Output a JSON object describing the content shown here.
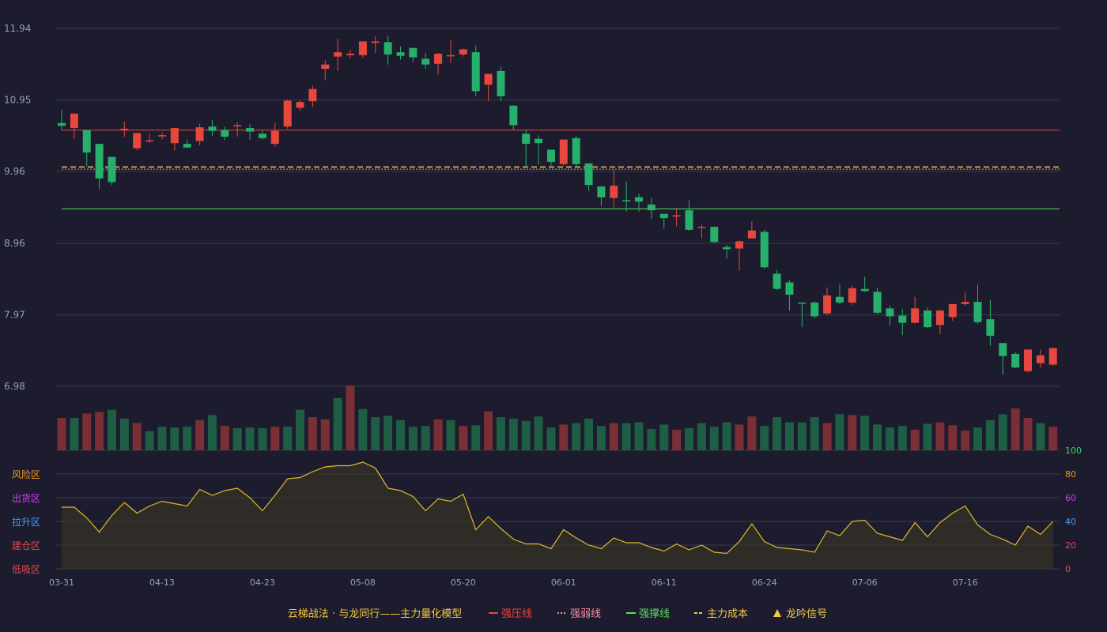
{
  "chart_data": [
    {
      "type": "candlestick",
      "y_ticks": [
        "11.94",
        "10.95",
        "9.96",
        "8.96",
        "7.97",
        "6.98"
      ],
      "ylim": [
        6.98,
        11.94
      ],
      "x_ticks": [
        "03-31",
        "04-13",
        "04-23",
        "05-08",
        "05-20",
        "06-01",
        "06-11",
        "06-24",
        "07-06",
        "07-16"
      ],
      "x_tick_index": [
        0,
        8,
        16,
        24,
        32,
        40,
        48,
        56,
        64,
        72
      ],
      "levels": {
        "strong_resistance": 10.53,
        "weak": 9.99,
        "strong_support": 9.44,
        "main_cost": 10.02
      },
      "candles": [
        [
          10.63,
          10.59,
          10.81,
          10.53
        ],
        [
          10.56,
          10.76,
          10.56,
          10.41
        ],
        [
          10.53,
          10.22,
          10.53,
          10.03
        ],
        [
          10.34,
          9.86,
          10.34,
          9.72
        ],
        [
          10.16,
          9.81,
          10.16,
          9.77
        ],
        [
          10.53,
          10.55,
          10.65,
          10.44
        ],
        [
          10.28,
          10.49,
          10.49,
          10.25
        ],
        [
          10.38,
          10.39,
          10.49,
          10.35
        ],
        [
          10.45,
          10.46,
          10.5,
          10.4
        ],
        [
          10.35,
          10.56,
          10.56,
          10.25
        ],
        [
          10.34,
          10.29,
          10.4,
          10.28
        ],
        [
          10.38,
          10.57,
          10.62,
          10.32
        ],
        [
          10.58,
          10.52,
          10.67,
          10.45
        ],
        [
          10.53,
          10.44,
          10.58,
          10.39
        ],
        [
          10.59,
          10.6,
          10.64,
          10.44
        ],
        [
          10.56,
          10.51,
          10.61,
          10.4
        ],
        [
          10.48,
          10.42,
          10.53,
          10.4
        ],
        [
          10.34,
          10.52,
          10.63,
          10.3
        ],
        [
          10.58,
          10.94,
          10.95,
          10.55
        ],
        [
          10.84,
          10.92,
          10.95,
          10.8
        ],
        [
          10.93,
          11.1,
          11.15,
          10.85
        ],
        [
          11.38,
          11.44,
          11.5,
          11.22
        ],
        [
          11.55,
          11.61,
          11.8,
          11.35
        ],
        [
          11.57,
          11.59,
          11.64,
          11.53
        ],
        [
          11.57,
          11.76,
          11.76,
          11.53
        ],
        [
          11.74,
          11.76,
          11.83,
          11.6
        ],
        [
          11.75,
          11.58,
          11.84,
          11.44
        ],
        [
          11.61,
          11.56,
          11.69,
          11.51
        ],
        [
          11.67,
          11.54,
          11.67,
          11.48
        ],
        [
          11.52,
          11.44,
          11.6,
          11.38
        ],
        [
          11.45,
          11.59,
          11.6,
          11.3
        ],
        [
          11.57,
          11.57,
          11.78,
          11.46
        ],
        [
          11.58,
          11.65,
          11.66,
          11.55
        ],
        [
          11.61,
          11.07,
          11.7,
          11.0
        ],
        [
          11.16,
          11.31,
          11.31,
          10.93
        ],
        [
          11.35,
          11.0,
          11.41,
          10.93
        ],
        [
          10.87,
          10.6,
          10.87,
          10.53
        ],
        [
          10.48,
          10.34,
          10.53,
          10.02
        ],
        [
          10.41,
          10.35,
          10.46,
          10.05
        ],
        [
          10.26,
          10.09,
          10.26,
          10.02
        ],
        [
          10.06,
          10.4,
          10.4,
          10.04
        ],
        [
          10.42,
          10.06,
          10.45,
          10.0
        ],
        [
          10.07,
          9.77,
          10.07,
          9.69
        ],
        [
          9.75,
          9.6,
          9.75,
          9.48
        ],
        [
          9.59,
          9.76,
          9.98,
          9.46
        ],
        [
          9.56,
          9.55,
          9.82,
          9.4
        ],
        [
          9.6,
          9.54,
          9.65,
          9.4
        ],
        [
          9.5,
          9.42,
          9.59,
          9.3
        ],
        [
          9.37,
          9.31,
          9.37,
          9.16
        ],
        [
          9.34,
          9.35,
          9.44,
          9.2
        ],
        [
          9.42,
          9.15,
          9.56,
          9.14
        ],
        [
          9.19,
          9.19,
          9.22,
          9.03
        ],
        [
          9.19,
          8.98,
          9.19,
          8.97
        ],
        [
          8.91,
          8.88,
          8.94,
          8.75
        ],
        [
          8.89,
          8.99,
          9.0,
          8.58
        ],
        [
          9.03,
          9.14,
          9.27,
          9.04
        ],
        [
          9.12,
          8.63,
          9.15,
          8.61
        ],
        [
          8.54,
          8.33,
          8.59,
          8.31
        ],
        [
          8.42,
          8.25,
          8.45,
          8.03
        ],
        [
          8.14,
          8.13,
          8.14,
          7.8
        ],
        [
          8.14,
          7.95,
          8.16,
          7.92
        ],
        [
          7.99,
          8.24,
          8.35,
          7.97
        ],
        [
          8.22,
          8.14,
          8.4,
          8.12
        ],
        [
          8.14,
          8.34,
          8.37,
          8.11
        ],
        [
          8.33,
          8.3,
          8.5,
          8.29
        ],
        [
          8.29,
          8.0,
          8.35,
          7.98
        ],
        [
          8.06,
          7.95,
          8.1,
          7.82
        ],
        [
          7.96,
          7.86,
          8.05,
          7.69
        ],
        [
          7.86,
          8.06,
          8.22,
          7.85
        ],
        [
          8.03,
          7.8,
          8.07,
          7.79
        ],
        [
          7.83,
          8.03,
          8.04,
          7.7
        ],
        [
          7.94,
          8.12,
          8.12,
          7.89
        ],
        [
          8.12,
          8.15,
          8.29,
          8.1
        ],
        [
          8.15,
          7.87,
          8.39,
          7.84
        ],
        [
          7.91,
          7.68,
          8.18,
          7.54
        ],
        [
          7.58,
          7.4,
          7.58,
          7.14
        ],
        [
          7.43,
          7.24,
          7.45,
          7.23
        ],
        [
          7.19,
          7.49,
          7.49,
          7.17
        ],
        [
          7.3,
          7.41,
          7.49,
          7.24
        ],
        [
          7.28,
          7.51,
          7.52,
          7.27
        ]
      ],
      "volume": [
        44,
        44,
        50,
        52,
        55,
        43,
        37,
        26,
        32,
        31,
        32,
        41,
        48,
        33,
        30,
        31,
        30,
        32,
        32,
        55,
        45,
        42,
        71,
        88,
        56,
        45,
        47,
        41,
        32,
        33,
        42,
        41,
        33,
        34,
        53,
        45,
        43,
        40,
        46,
        31,
        35,
        37,
        43,
        33,
        37,
        37,
        38,
        29,
        35,
        28,
        30,
        37,
        32,
        38,
        35,
        46,
        33,
        45,
        38,
        38,
        45,
        37,
        49,
        48,
        47,
        35,
        31,
        33,
        28,
        36,
        38,
        34,
        27,
        31,
        41,
        49,
        57,
        44,
        37,
        32
      ],
      "volume_up": [
        true,
        false,
        true,
        true,
        false,
        false,
        true,
        false,
        false,
        false,
        false,
        true,
        false,
        true,
        false,
        false,
        false,
        true,
        false,
        false,
        true,
        true,
        false,
        true,
        false,
        false,
        false,
        false,
        false,
        false,
        true,
        false,
        true,
        false,
        true,
        false,
        false,
        false,
        false,
        false,
        true,
        false,
        false,
        false,
        true,
        false,
        false,
        false,
        false,
        true,
        false,
        false,
        false,
        false,
        true,
        true,
        false,
        false,
        false,
        false,
        false,
        true,
        false,
        true,
        false,
        false,
        false,
        false,
        true,
        false,
        true,
        true,
        true,
        false,
        false,
        false,
        true,
        true,
        false,
        true
      ]
    },
    {
      "type": "line",
      "ylim": [
        0,
        100
      ],
      "y_ticks": [
        "100",
        "80",
        "60",
        "40",
        "20",
        "0"
      ],
      "zone_labels": [
        "风险区",
        "出货区",
        "拉升区",
        "建仓区",
        "低吸区"
      ],
      "values": [
        52,
        52,
        43,
        31,
        45,
        56,
        47,
        53,
        57,
        55,
        53,
        67,
        62,
        66,
        68,
        60,
        49,
        62,
        76,
        77,
        82,
        86,
        87,
        87,
        90,
        85,
        68,
        66,
        61,
        49,
        59,
        57,
        63,
        33,
        44,
        34,
        25,
        21,
        21,
        17,
        33,
        26,
        20,
        17,
        26,
        22,
        22,
        18,
        15,
        21,
        16,
        20,
        14,
        13,
        23,
        38,
        23,
        18,
        17,
        16,
        14,
        32,
        28,
        40,
        41,
        30,
        27,
        24,
        39,
        27,
        39,
        47,
        53,
        37,
        29,
        25,
        20,
        36,
        29,
        40
      ]
    }
  ],
  "legend": {
    "title": "云梯战法 · 与龙同行——主力量化模型",
    "items": [
      {
        "label": "强压线",
        "color": "#e8473d",
        "style": "solid"
      },
      {
        "label": "强弱线",
        "color": "#ff8fa3",
        "style": "dotted"
      },
      {
        "label": "强撑线",
        "color": "#5dde5d",
        "style": "solid"
      },
      {
        "label": "主力成本",
        "color": "#f5c842",
        "style": "dashed"
      },
      {
        "label": "龙吟信号",
        "color": "#f5c842",
        "style": "triangle"
      }
    ]
  },
  "colors": {
    "up": "#e8473d",
    "down": "#26b06b",
    "vol_up": "#7a2e35",
    "vol_down": "#1e5e45",
    "line": "#e0b82a",
    "grid": "#3a3a4c",
    "axis_text": "#9aa0aa",
    "zone_colors": [
      "#f39c12",
      "#d63af9",
      "#4a9df3",
      "#e84848",
      "#e84848"
    ],
    "right_tick_colors": [
      "#36d86a",
      "#f39c12",
      "#d63af9",
      "#4a9df3",
      "#e84848",
      "#e84848"
    ]
  }
}
